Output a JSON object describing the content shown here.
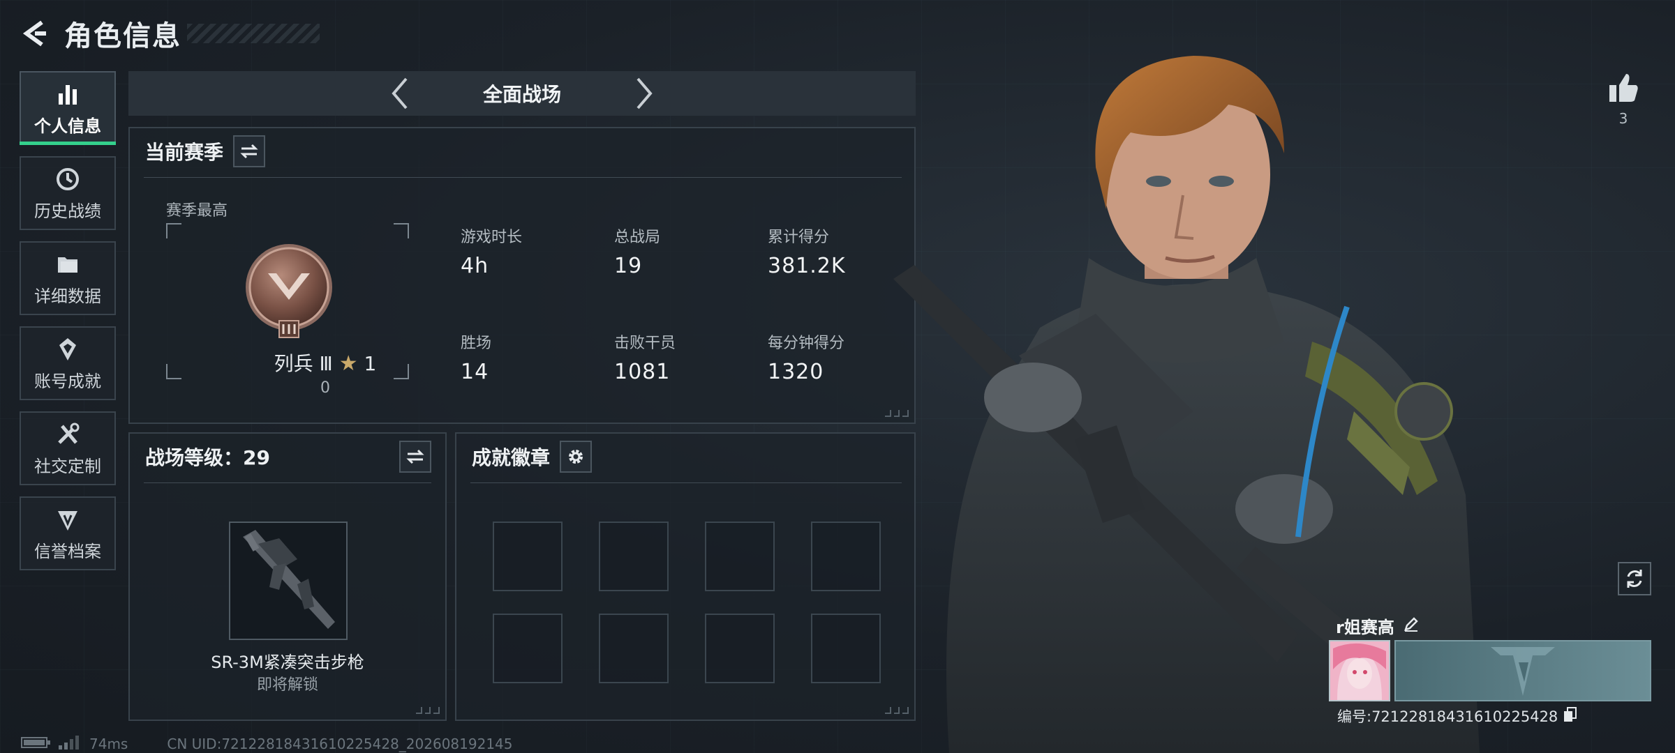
{
  "header": {
    "title": "角色信息"
  },
  "sidebar": {
    "items": [
      {
        "label": "个人信息",
        "icon": "bar-chart-icon",
        "active": true
      },
      {
        "label": "历史战绩",
        "icon": "history-icon",
        "active": false
      },
      {
        "label": "详细数据",
        "icon": "folder-icon",
        "active": false
      },
      {
        "label": "账号成就",
        "icon": "achievement-icon",
        "active": false
      },
      {
        "label": "社交定制",
        "icon": "tools-icon",
        "active": false
      },
      {
        "label": "信誉档案",
        "icon": "reputation-icon",
        "active": false
      }
    ]
  },
  "mode": {
    "title": "全面战场"
  },
  "season": {
    "title": "当前赛季",
    "best_label": "赛季最高",
    "rank_name": "列兵 Ⅲ",
    "rank_stars": "1",
    "rank_points": "0",
    "stats": [
      {
        "label": "游戏时长",
        "value": "4h"
      },
      {
        "label": "总战局",
        "value": "19"
      },
      {
        "label": "累计得分",
        "value": "381.2K"
      },
      {
        "label": "胜场",
        "value": "14"
      },
      {
        "label": "击败干员",
        "value": "1081"
      },
      {
        "label": "每分钟得分",
        "value": "1320"
      }
    ]
  },
  "level": {
    "title": "战场等级：29",
    "weapon_name": "SR-3M紧凑突击步枪",
    "weapon_status": "即将解锁"
  },
  "achievement": {
    "title": "成就徽章"
  },
  "profile": {
    "like_count": "3",
    "player_name": "r姐赛高",
    "player_id": "编号:7212281843161022542​8"
  },
  "footer": {
    "ping": "74ms",
    "uid": "CN UID:7212281843161022542​8_202608192145"
  },
  "colors": {
    "accent": "#34d08c",
    "panel_border": "#38424b"
  }
}
